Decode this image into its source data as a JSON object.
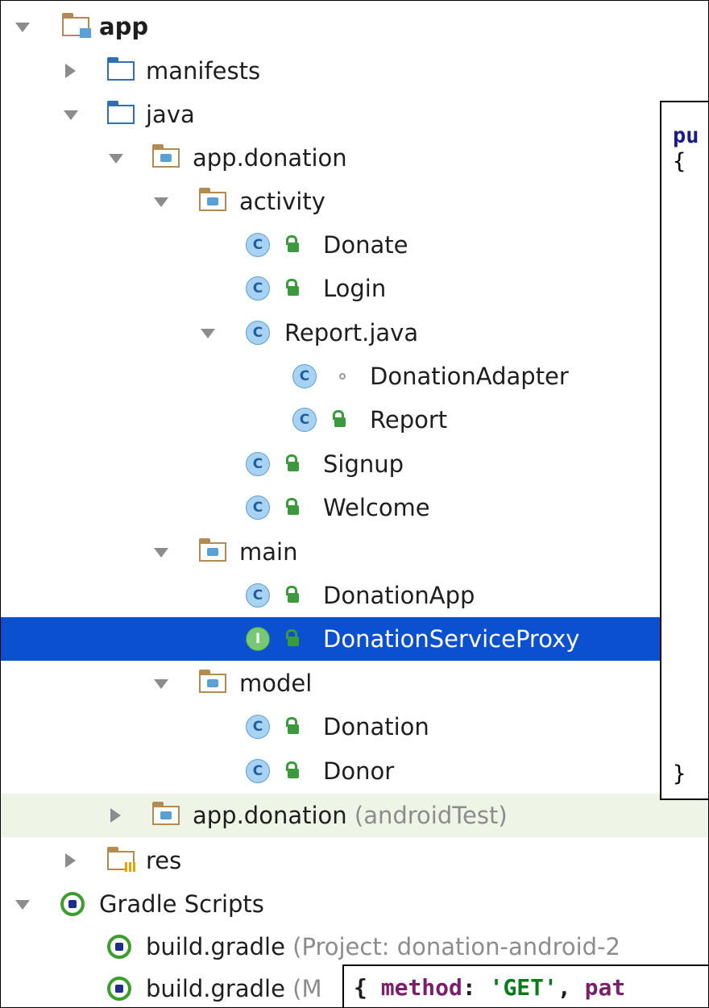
{
  "tree": {
    "app": "app",
    "manifests": "manifests",
    "java": "java",
    "pkg_main": "app.donation",
    "activity": "activity",
    "donate": "Donate",
    "login": "Login",
    "report_java": "Report.java",
    "donation_adapter": "DonationAdapter",
    "report": "Report",
    "signup": "Signup",
    "welcome": "Welcome",
    "main": "main",
    "donation_app": "DonationApp",
    "donation_service_proxy": "DonationServiceProxy",
    "model": "model",
    "donation": "Donation",
    "donor": "Donor",
    "pkg_test": "app.donation",
    "pkg_test_suffix": "(androidTest)",
    "res": "res",
    "gradle_scripts": "Gradle Scripts",
    "build_gradle_1": "build.gradle",
    "build_gradle_1_suffix": "(Project: donation-android-2",
    "build_gradle_2": "build.gradle",
    "build_gradle_2_suffix": "(M",
    "class_badge": "C",
    "interface_badge": "I"
  },
  "code_overlay": {
    "keyword_fragment": "pu",
    "open_brace": "{",
    "close_brace": "}"
  },
  "bottom_overlay": {
    "open": "{ ",
    "method_key": "method",
    "colon1": ": ",
    "method_val": "'GET'",
    "comma": ", ",
    "path_key": "pat"
  },
  "colors": {
    "selection": "#0b50d0",
    "test_row": "#eef5e6",
    "folder": "#b38b50",
    "lock": "#3c9a3c"
  }
}
